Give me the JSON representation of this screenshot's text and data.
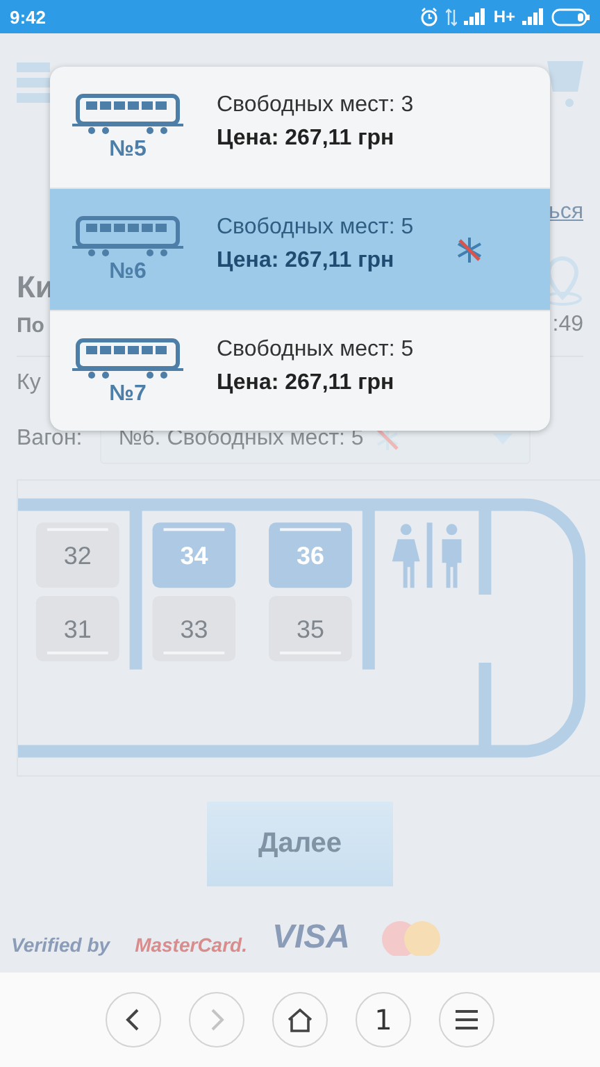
{
  "status_bar": {
    "time": "9:42",
    "network": "H+"
  },
  "page": {
    "link_fragment": "ься",
    "title_fragment": "Ки",
    "route_fragment": "По",
    "time_fragment": ":49",
    "class_fragment": "Ку",
    "wagon_label": "Вагон:",
    "wagon_value": "№6. Свободных мест: 5",
    "wagon_ac_off": true,
    "seats": [
      {
        "number": "32",
        "available": false,
        "kind": "upper"
      },
      {
        "number": "31",
        "available": false,
        "kind": "lower"
      },
      {
        "number": "34",
        "available": true,
        "kind": "upper"
      },
      {
        "number": "33",
        "available": false,
        "kind": "lower"
      },
      {
        "number": "36",
        "available": true,
        "kind": "upper"
      },
      {
        "number": "35",
        "available": false,
        "kind": "lower"
      }
    ],
    "next_button": "Далее",
    "next_disabled": true,
    "payment_logos": [
      "Verified by",
      "MasterCard.",
      "VISA"
    ]
  },
  "wagon_menu": [
    {
      "number": "№5",
      "seats_text": "Свободных мест: 3",
      "price": "Цена: 267,11 грн",
      "selected": false,
      "ac_off": false
    },
    {
      "number": "№6",
      "seats_text": "Свободных мест: 5",
      "price": "Цена: 267,11 грн",
      "selected": true,
      "ac_off": true
    },
    {
      "number": "№7",
      "seats_text": "Свободных мест: 5",
      "price": "Цена: 267,11 грн",
      "selected": false,
      "ac_off": false
    }
  ],
  "browser_bar": {
    "tab_count": "1",
    "forward_disabled": true
  }
}
